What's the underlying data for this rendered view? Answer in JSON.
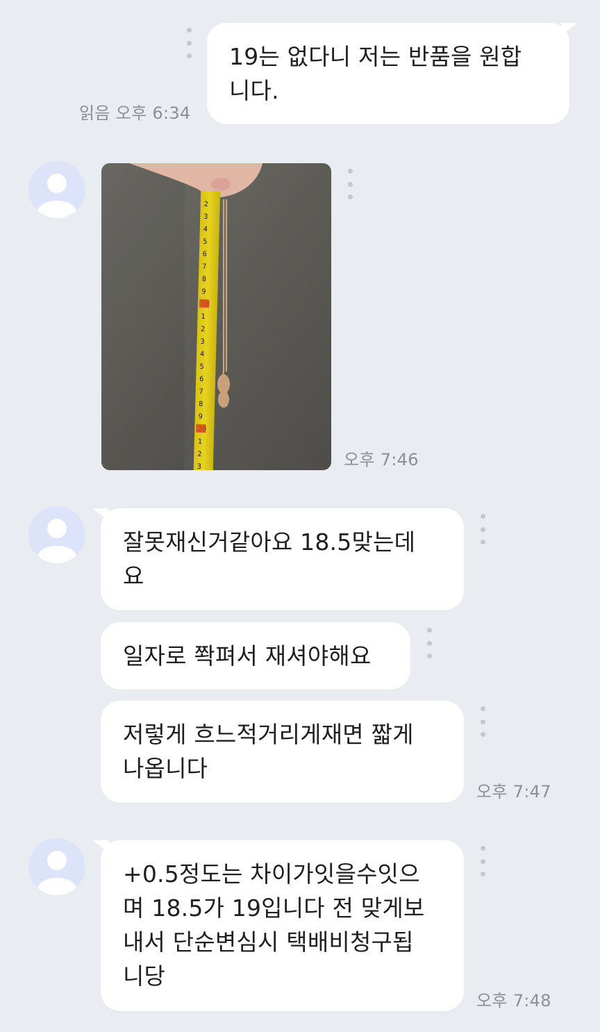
{
  "messages": [
    {
      "id": "m1",
      "direction": "sent",
      "text": "19는 없다니 저는 반품을 원합\n니다.",
      "read_time": "읽음 오후 6:34"
    },
    {
      "id": "m2",
      "direction": "received",
      "attachment": "tape-measure-bracelet-photo",
      "time": "오후 7:46"
    },
    {
      "id": "m3",
      "direction": "received",
      "text": "잘못재신거같아요 18.5맞는데\n요"
    },
    {
      "id": "m4",
      "direction": "received",
      "text": "일자로 쫙펴서 재셔야해요"
    },
    {
      "id": "m5",
      "direction": "received",
      "text": "저렇게 흐느적거리게재면 짧게\n나옵니다",
      "time": "오후 7:47"
    },
    {
      "id": "m6",
      "direction": "received",
      "text": "+0.5정도는 차이가잇을수잇으\n며 18.5가 19입니다 전 맞게보\n내서 단순변심시 택배비청구됩\n니당",
      "time": "오후 7:48"
    }
  ],
  "icons": {
    "avatar": "default-user-icon",
    "more": "more-vertical-icon"
  },
  "colors": {
    "background": "#e9ecf0",
    "bubble": "#ffffff",
    "avatar_bg": "#dde3f9",
    "time_text": "#8c9096",
    "more_dots": "#c4c8cd"
  }
}
